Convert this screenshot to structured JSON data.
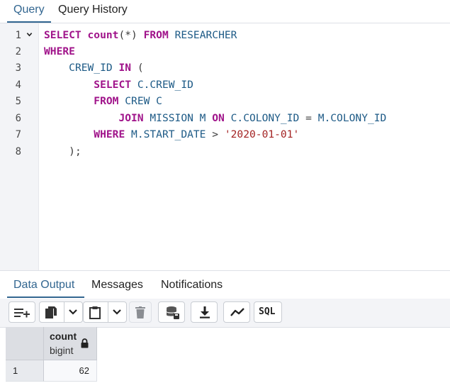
{
  "editor_tabs": [
    {
      "label": "Query",
      "active": true
    },
    {
      "label": "Query History",
      "active": false
    }
  ],
  "editor": {
    "line_numbers": [
      "1",
      "2",
      "3",
      "4",
      "5",
      "6",
      "7",
      "8"
    ]
  },
  "output_tabs": [
    {
      "label": "Data Output",
      "active": true
    },
    {
      "label": "Messages",
      "active": false
    },
    {
      "label": "Notifications",
      "active": false
    }
  ],
  "toolbar": {
    "buttons": [
      "add-row-icon",
      "copy-icon",
      "chevron-down-icon",
      "paste-icon",
      "chevron-down-icon",
      "delete-icon",
      "save-data-icon",
      "download-icon",
      "graph-visualiser-icon",
      "sql-icon"
    ],
    "sql_label": "SQL"
  },
  "grid": {
    "columns": [
      {
        "name": "count",
        "type": "bigint",
        "readonly_icon": "lock-icon"
      }
    ],
    "rows": [
      {
        "row_number": "1",
        "cells": [
          "62"
        ]
      }
    ]
  },
  "colors": {
    "accent": "#326690",
    "keyword": "#a0138a",
    "identifier": "#1d5a86",
    "string": "#a32222"
  }
}
